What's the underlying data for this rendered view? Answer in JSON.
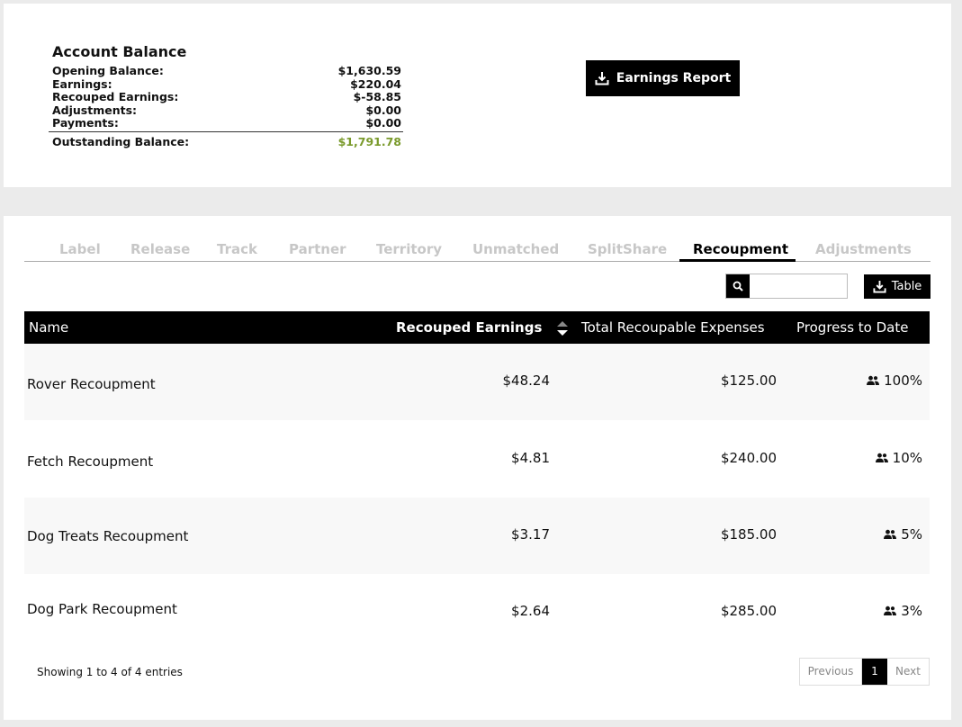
{
  "account_balance": {
    "title": "Account Balance",
    "rows": [
      {
        "label": "Opening Balance:",
        "value": "$1,630.59"
      },
      {
        "label": "Earnings:",
        "value": "$220.04"
      },
      {
        "label": "Recouped Earnings:",
        "value": "$-58.85"
      },
      {
        "label": "Adjustments:",
        "value": "$0.00"
      },
      {
        "label": "Payments:",
        "value": "$0.00"
      }
    ],
    "total_label": "Outstanding Balance:",
    "total_value": "$1,791.78",
    "total_color": "#7a9a2c"
  },
  "earnings_button": {
    "label": "Earnings Report",
    "icon": "download-icon"
  },
  "tabs": [
    {
      "label": "Label",
      "active": false
    },
    {
      "label": "Release",
      "active": false
    },
    {
      "label": "Track",
      "active": false
    },
    {
      "label": "Partner",
      "active": false
    },
    {
      "label": "Territory",
      "active": false
    },
    {
      "label": "Unmatched",
      "active": false
    },
    {
      "label": "SplitShare",
      "active": false
    },
    {
      "label": "Recoupment",
      "active": true
    },
    {
      "label": "Adjustments",
      "active": false
    }
  ],
  "search": {
    "placeholder": "",
    "value": "",
    "icon": "search-icon"
  },
  "table_button": {
    "label": "Table",
    "icon": "download-icon"
  },
  "table": {
    "columns": [
      "Name",
      "Recouped Earnings",
      "Total Recoupable Expenses",
      "Progress to Date"
    ],
    "sorted_column": "Recouped Earnings",
    "rows": [
      {
        "name": "Rover Recoupment",
        "recouped": "$48.24",
        "total": "$125.00",
        "progress": "100%"
      },
      {
        "name": "Fetch Recoupment",
        "recouped": "$4.81",
        "total": "$240.00",
        "progress": "10%"
      },
      {
        "name": "Dog Treats Recoupment",
        "recouped": "$3.17",
        "total": "$185.00",
        "progress": "5%"
      },
      {
        "name": "Dog Park Recoupment",
        "recouped": "$2.64",
        "total": "$285.00",
        "progress": "3%"
      }
    ],
    "progress_icon": "users-icon"
  },
  "footer": {
    "entries_info": "Showing 1 to 4 of 4 entries",
    "prev_label": "Previous",
    "current_page": "1",
    "next_label": "Next"
  }
}
